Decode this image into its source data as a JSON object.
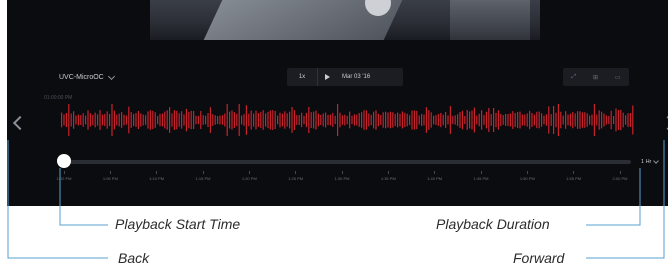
{
  "player": {
    "camera_name": "UVC-MicroOC",
    "speed": "1x",
    "date": "Mar 03 '16",
    "start_time_label": "01:00:00 PM",
    "duration": "1 Hr",
    "ticks": [
      "1:00 PM",
      "1:05 PM",
      "1:10 PM",
      "1:15 PM",
      "1:20 PM",
      "1:25 PM",
      "1:30 PM",
      "1:35 PM",
      "1:40 PM",
      "1:45 PM",
      "1:50 PM",
      "1:55 PM",
      "2:00 PM"
    ],
    "view_icons": [
      "expand-icon",
      "grid-icon",
      "layout-icon"
    ],
    "accent_color": "#c8232a",
    "playback_position_fraction": 0.0
  },
  "callouts": {
    "playback_start_time": "Playback Start Time",
    "playback_duration": "Playback Duration",
    "back": "Back",
    "forward": "Forward"
  }
}
